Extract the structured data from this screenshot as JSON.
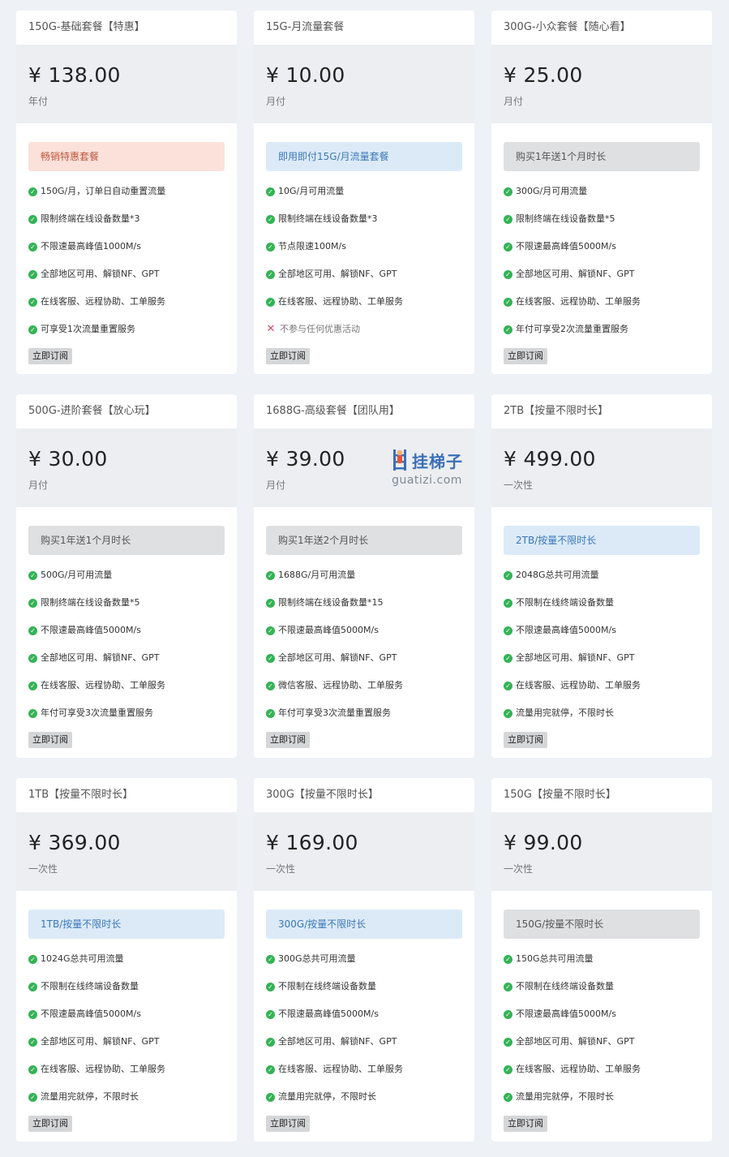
{
  "plans": [
    {
      "title": "150G-基础套餐【特惠】",
      "price": "¥ 138.00",
      "cycle": "年付",
      "tag": "畅销特惠套餐",
      "tag_style": "red",
      "features": [
        {
          "text": "150G/月，订单日自动重置流量",
          "ok": true
        },
        {
          "text": "限制终端在线设备数量*3",
          "ok": true
        },
        {
          "text": "不限速最高峰值1000M/s",
          "ok": true
        },
        {
          "text": "全部地区可用、解锁NF、GPT",
          "ok": true
        },
        {
          "text": "在线客服、远程协助、工单服务",
          "ok": true
        },
        {
          "text": "可享受1次流量重置服务",
          "ok": true
        }
      ],
      "button": "立即订阅"
    },
    {
      "title": "15G-月流量套餐",
      "price": "¥ 10.00",
      "cycle": "月付",
      "tag": "即用即付15G/月流量套餐",
      "tag_style": "blue",
      "features": [
        {
          "text": "10G/月可用流量",
          "ok": true
        },
        {
          "text": "限制终端在线设备数量*3",
          "ok": true
        },
        {
          "text": "节点限速100M/s",
          "ok": true
        },
        {
          "text": "全部地区可用、解锁NF、GPT",
          "ok": true
        },
        {
          "text": "在线客服、远程协助、工单服务",
          "ok": true
        },
        {
          "text": "不参与任何优惠活动",
          "ok": false
        }
      ],
      "button": "立即订阅"
    },
    {
      "title": "300G-小众套餐【随心看】",
      "price": "¥ 25.00",
      "cycle": "月付",
      "tag": "购买1年送1个月时长",
      "tag_style": "gray",
      "features": [
        {
          "text": "300G/月可用流量",
          "ok": true
        },
        {
          "text": "限制终端在线设备数量*5",
          "ok": true
        },
        {
          "text": "不限速最高峰值5000M/s",
          "ok": true
        },
        {
          "text": "全部地区可用、解锁NF、GPT",
          "ok": true
        },
        {
          "text": "在线客服、远程协助、工单服务",
          "ok": true
        },
        {
          "text": "年付可享受2次流量重置服务",
          "ok": true
        }
      ],
      "button": "立即订阅"
    },
    {
      "title": "500G-进阶套餐【放心玩】",
      "price": "¥ 30.00",
      "cycle": "月付",
      "tag": "购买1年送1个月时长",
      "tag_style": "gray",
      "features": [
        {
          "text": "500G/月可用流量",
          "ok": true
        },
        {
          "text": "限制终端在线设备数量*5",
          "ok": true
        },
        {
          "text": "不限速最高峰值5000M/s",
          "ok": true
        },
        {
          "text": "全部地区可用、解锁NF、GPT",
          "ok": true
        },
        {
          "text": "在线客服、远程协助、工单服务",
          "ok": true
        },
        {
          "text": "年付可享受3次流量重置服务",
          "ok": true
        }
      ],
      "button": "立即订阅"
    },
    {
      "title": "1688G-高级套餐【团队用】",
      "price": "¥ 39.00",
      "cycle": "月付",
      "tag": "购买1年送2个月时长",
      "tag_style": "gray",
      "features": [
        {
          "text": "1688G/月可用流量",
          "ok": true
        },
        {
          "text": "限制终端在线设备数量*15",
          "ok": true
        },
        {
          "text": "不限速最高峰值5000M/s",
          "ok": true
        },
        {
          "text": "全部地区可用、解锁NF、GPT",
          "ok": true
        },
        {
          "text": "微信客服、远程协助、工单服务",
          "ok": true
        },
        {
          "text": "年付可享受3次流量重置服务",
          "ok": true
        }
      ],
      "button": "立即订阅",
      "watermark": {
        "text": "挂梯子",
        "url": "guatizi.com"
      }
    },
    {
      "title": "2TB【按量不限时长】",
      "price": "¥ 499.00",
      "cycle": "一次性",
      "tag": "2TB/按量不限时长",
      "tag_style": "blue",
      "features": [
        {
          "text": "2048G总共可用流量",
          "ok": true
        },
        {
          "text": "不限制在线终端设备数量",
          "ok": true
        },
        {
          "text": "不限速最高峰值5000M/s",
          "ok": true
        },
        {
          "text": "全部地区可用、解锁NF、GPT",
          "ok": true
        },
        {
          "text": "在线客服、远程协助、工单服务",
          "ok": true
        },
        {
          "text": "流量用完就停，不限时长",
          "ok": true
        }
      ],
      "button": "立即订阅"
    },
    {
      "title": "1TB【按量不限时长】",
      "price": "¥ 369.00",
      "cycle": "一次性",
      "tag": "1TB/按量不限时长",
      "tag_style": "blue",
      "features": [
        {
          "text": "1024G总共可用流量",
          "ok": true
        },
        {
          "text": "不限制在线终端设备数量",
          "ok": true
        },
        {
          "text": "不限速最高峰值5000M/s",
          "ok": true
        },
        {
          "text": "全部地区可用、解锁NF、GPT",
          "ok": true
        },
        {
          "text": "在线客服、远程协助、工单服务",
          "ok": true
        },
        {
          "text": "流量用完就停，不限时长",
          "ok": true
        }
      ],
      "button": "立即订阅"
    },
    {
      "title": "300G【按量不限时长】",
      "price": "¥ 169.00",
      "cycle": "一次性",
      "tag": "300G/按量不限时长",
      "tag_style": "blue",
      "features": [
        {
          "text": "300G总共可用流量",
          "ok": true
        },
        {
          "text": "不限制在线终端设备数量",
          "ok": true
        },
        {
          "text": "不限速最高峰值5000M/s",
          "ok": true
        },
        {
          "text": "全部地区可用、解锁NF、GPT",
          "ok": true
        },
        {
          "text": "在线客服、远程协助、工单服务",
          "ok": true
        },
        {
          "text": "流量用完就停，不限时长",
          "ok": true
        }
      ],
      "button": "立即订阅"
    },
    {
      "title": "150G【按量不限时长】",
      "price": "¥ 99.00",
      "cycle": "一次性",
      "tag": "150G/按量不限时长",
      "tag_style": "gray",
      "features": [
        {
          "text": "150G总共可用流量",
          "ok": true
        },
        {
          "text": "不限制在线终端设备数量",
          "ok": true
        },
        {
          "text": "不限速最高峰值5000M/s",
          "ok": true
        },
        {
          "text": "全部地区可用、解锁NF、GPT",
          "ok": true
        },
        {
          "text": "在线客服、远程协助、工单服务",
          "ok": true
        },
        {
          "text": "流量用完就停，不限时长",
          "ok": true
        }
      ],
      "button": "立即订阅"
    }
  ],
  "icons": {
    "ok": "check-circle-icon",
    "no": "cross-icon"
  },
  "colors": {
    "ok": "#34b355",
    "no": "#e04b5a",
    "watermark": "#3b6fb6"
  }
}
